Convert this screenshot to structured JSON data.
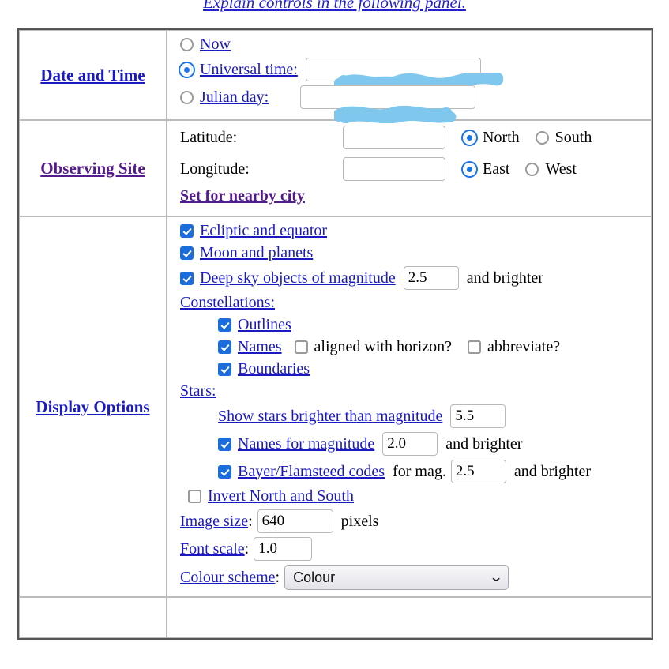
{
  "header": {
    "explain_link": "Explain controls in the following panel."
  },
  "sections": {
    "date_time": {
      "label": "Date and Time",
      "options": [
        {
          "label": "Now",
          "selected": false
        },
        {
          "label": "Universal time:",
          "selected": true
        },
        {
          "label": "Julian day:",
          "selected": false
        }
      ],
      "universal_time_value": "",
      "julian_day_value": ""
    },
    "observing_site": {
      "label": "Observing Site",
      "latitude_label": "Latitude:",
      "latitude_value": "",
      "latitude_hemispheres": [
        {
          "label": "North",
          "selected": true
        },
        {
          "label": "South",
          "selected": false
        }
      ],
      "longitude_label": "Longitude:",
      "longitude_value": "",
      "longitude_hemispheres": [
        {
          "label": "East",
          "selected": true
        },
        {
          "label": "West",
          "selected": false
        }
      ],
      "nearby_city_link": "Set for nearby city"
    },
    "display_options": {
      "label": "Display Options",
      "ecliptic_and_equator": {
        "label": "Ecliptic and equator",
        "checked": true
      },
      "moon_and_planets": {
        "label": "Moon and planets",
        "checked": true
      },
      "deep_sky": {
        "label": "Deep sky objects of magnitude",
        "checked": true,
        "value": "2.5",
        "suffix": "and brighter"
      },
      "constellations_label": "Constellations:",
      "constellations": {
        "outlines": {
          "label": "Outlines",
          "checked": true
        },
        "names": {
          "label": "Names",
          "checked": true
        },
        "aligned_with_horizon": {
          "label": "aligned with horizon?",
          "checked": false
        },
        "abbreviate": {
          "label": "abbreviate?",
          "checked": false
        },
        "boundaries": {
          "label": "Boundaries",
          "checked": true
        }
      },
      "stars_label": "Stars:",
      "stars": {
        "show_brighter_than": {
          "label": "Show stars brighter than magnitude",
          "value": "5.5"
        },
        "names_for_magnitude": {
          "label": "Names for magnitude",
          "checked": true,
          "value": "2.0",
          "suffix": "and brighter"
        },
        "bayer_flamsteed": {
          "label": "Bayer/Flamsteed codes",
          "checked": true,
          "mid": "for mag.",
          "value": "2.5",
          "suffix": "and brighter"
        }
      },
      "invert_north_south": {
        "label": "Invert North and South",
        "checked": false
      },
      "image_size": {
        "label": "Image size",
        "separator": ":",
        "value": "640",
        "suffix": "pixels"
      },
      "font_scale": {
        "label": "Font scale",
        "separator": ":",
        "value": "1.0"
      },
      "colour_scheme": {
        "label": "Colour scheme",
        "separator": ":",
        "value": "Colour"
      }
    }
  },
  "colors": {
    "link": "#1a1ac0",
    "visited_link": "#551a8b",
    "checkbox_on": "#1b6ddb",
    "radio_on": "#1a73e8",
    "redaction": "#7fc7ec",
    "table_border": "#555555"
  }
}
